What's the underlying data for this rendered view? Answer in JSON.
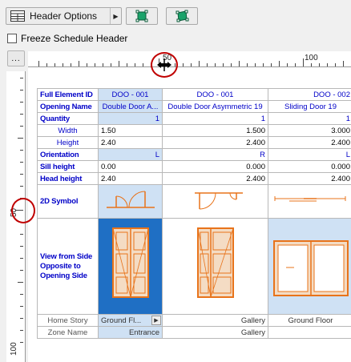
{
  "toolbar": {
    "header_options_label": "Header Options",
    "freeze_label": "Freeze Schedule Header",
    "more_label": "..."
  },
  "rulers": {
    "h_labels": [
      "50",
      "100"
    ],
    "v_labels": [
      "50",
      "100"
    ]
  },
  "schedule": {
    "labels": {
      "full_id": "Full Element ID",
      "opening_name": "Opening Name",
      "quantity": "Quantity",
      "width": "Width",
      "height": "Height",
      "orientation": "Orientation",
      "sill": "Sill height",
      "head": "Head height",
      "symbol": "2D Symbol",
      "view_line1": "View from Side",
      "view_line2": "Opposite to",
      "view_line3": "Opening Side",
      "home_story": "Home Story",
      "zone_name": "Zone Name"
    },
    "columns": [
      {
        "id": "DOO - 001",
        "name": "Double Door A...",
        "qty": "1",
        "width": "1.50",
        "height": "2.40",
        "orient": "L",
        "sill": "0.00",
        "head": "2.40",
        "story": "Ground Fl...",
        "zone": "Entrance"
      },
      {
        "id": "DOO - 001",
        "name": "Double Door Asymmetric 19",
        "qty": "1",
        "width": "1.500",
        "height": "2.400",
        "orient": "R",
        "sill": "0.000",
        "head": "2.400",
        "story": "Gallery",
        "zone": "Gallery"
      },
      {
        "id": "DOO - 002",
        "name": "Sliding Door 19",
        "qty": "1",
        "width": "3.000",
        "height": "2.400",
        "orient": "L",
        "sill": "0.000",
        "head": "2.400",
        "story": "Ground Floor",
        "zone": ""
      }
    ]
  },
  "colors": {
    "header_text": "#0000c8",
    "selection": "#cfe1f4",
    "selection_dark": "#1f6fc4",
    "door_orange": "#e8731a",
    "highlight_circle": "#c00000"
  },
  "icons": [
    "header-options-icon",
    "dropdown-arrow-icon",
    "select-cell-icon",
    "select-column-icon",
    "resize-cursor-icon",
    "story-dropdown-icon"
  ]
}
